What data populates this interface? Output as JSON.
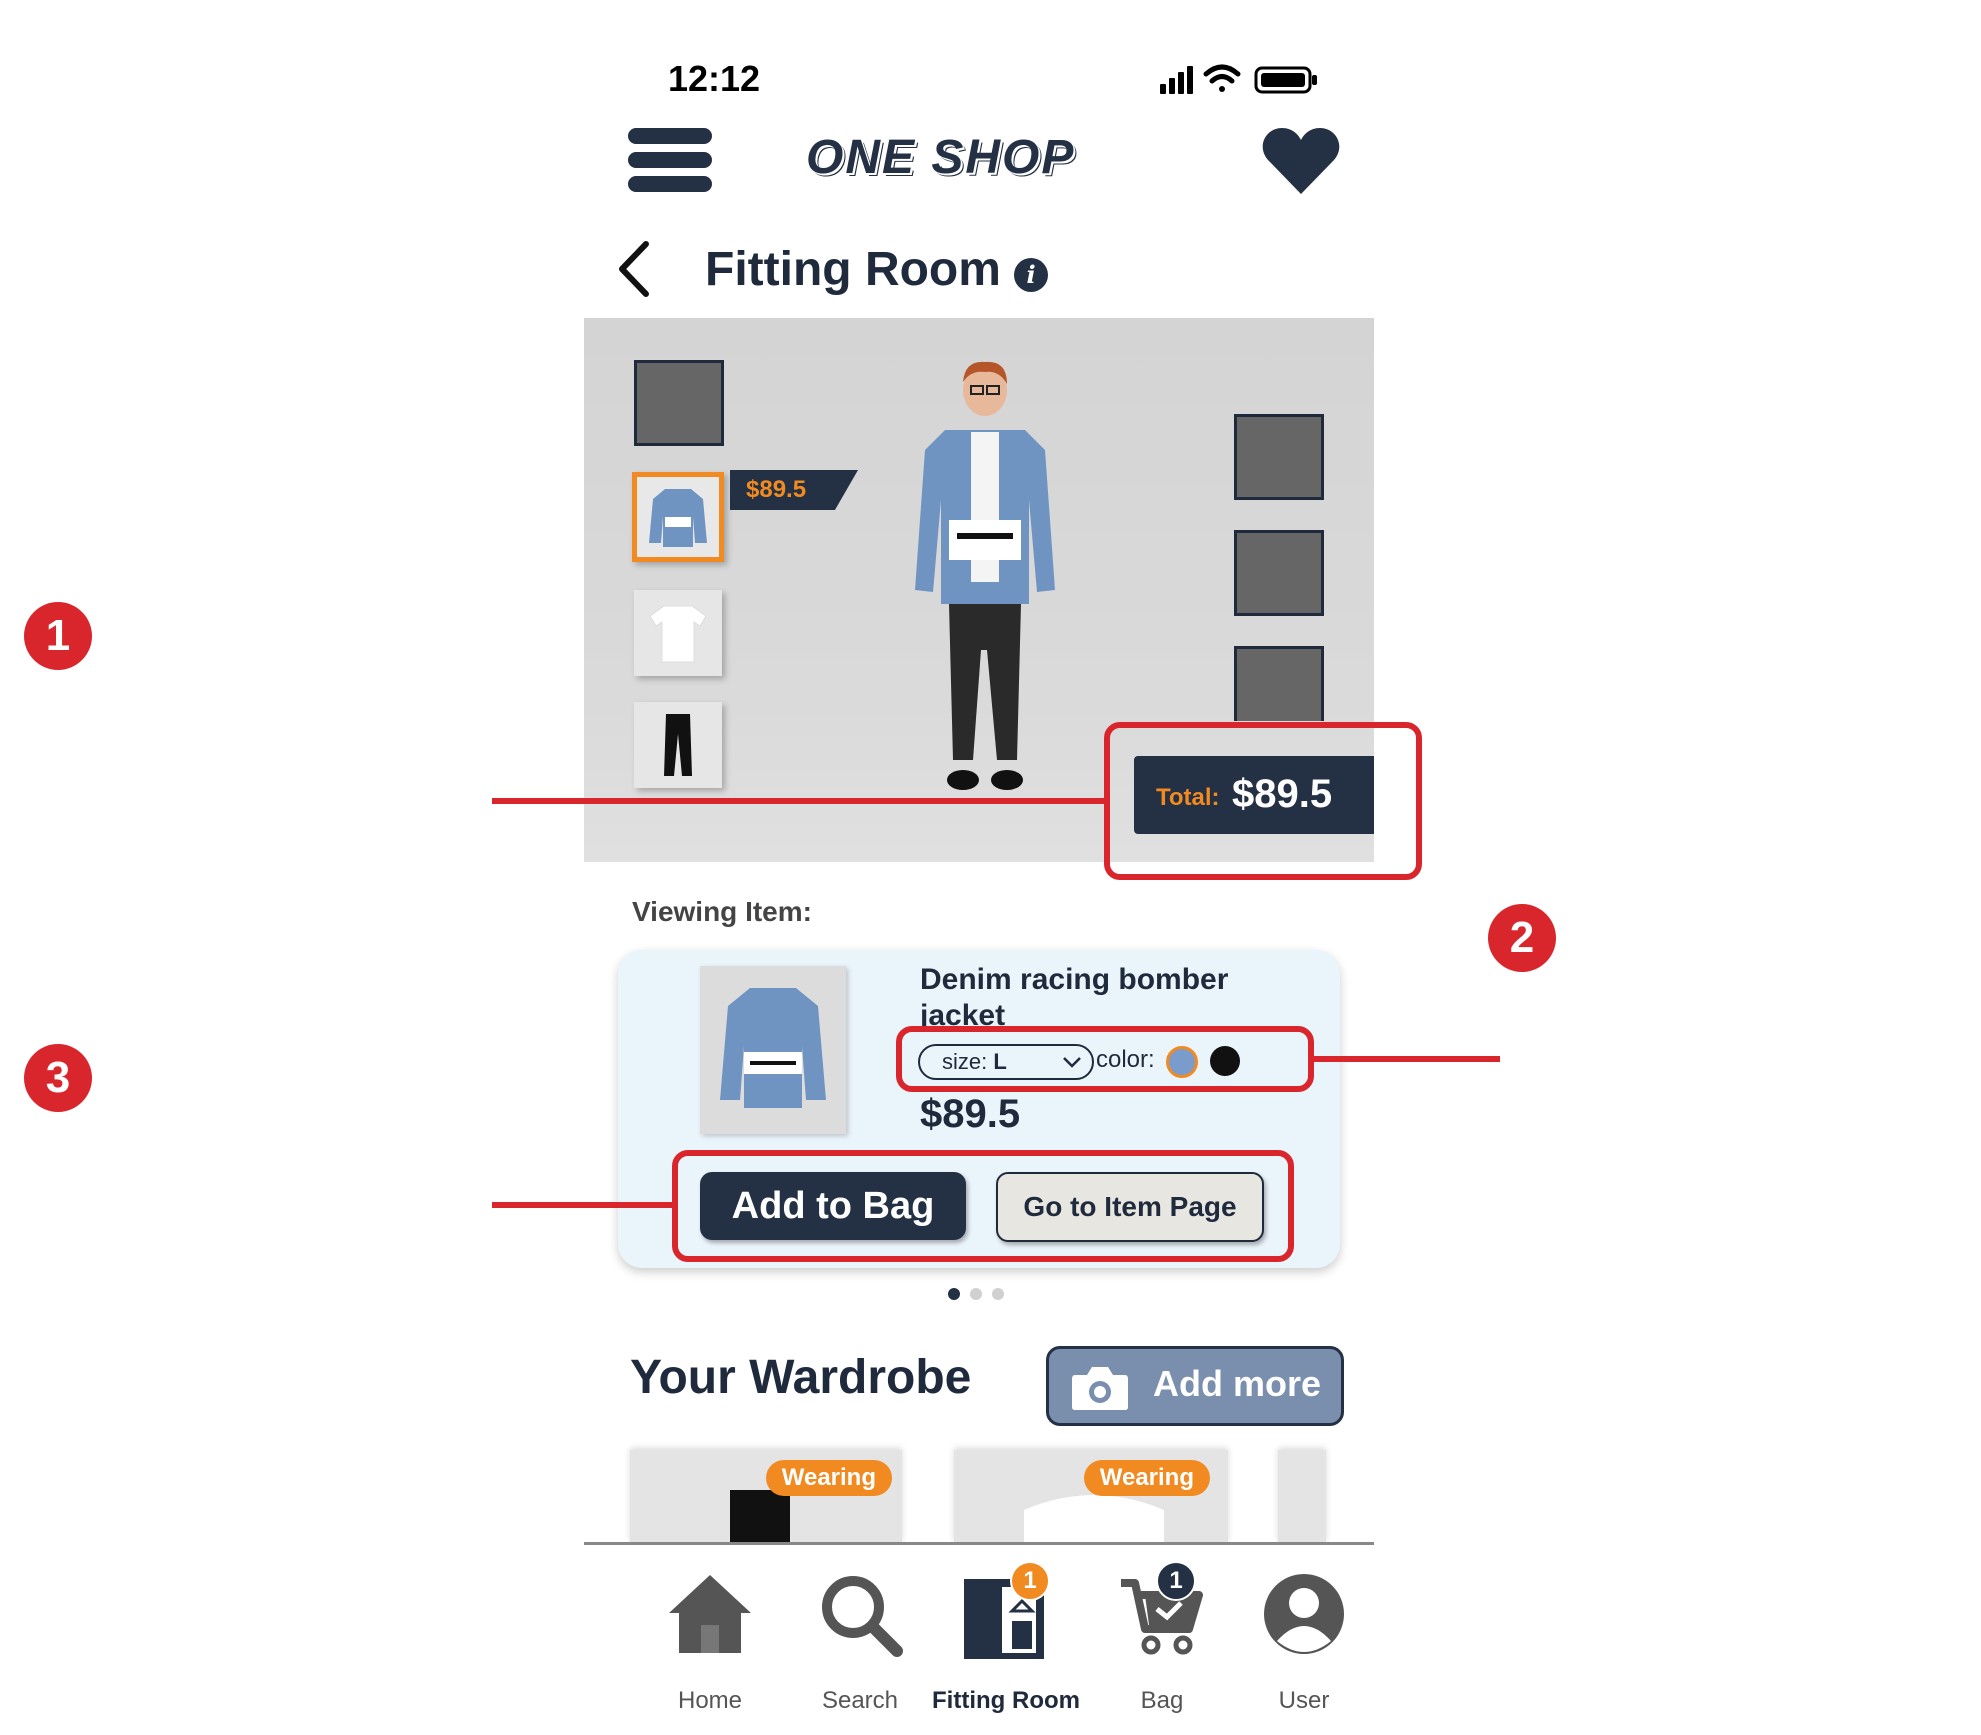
{
  "status_bar": {
    "time": "12:12"
  },
  "header": {
    "logo_text": "ONE SHOP"
  },
  "title_row": {
    "title": "Fitting Room"
  },
  "stage": {
    "selected_item_price": "$89.5",
    "total_label": "Total:",
    "total_value": "$89.5"
  },
  "annotations": {
    "badge_1": "1",
    "badge_2": "2",
    "badge_3": "3"
  },
  "viewing": {
    "label": "Viewing Item:",
    "item_name": "Denim racing bomber jacket",
    "size_label": "size:",
    "size_value": "L",
    "color_label": "color:",
    "colors": [
      "#7a9ccc",
      "#111111"
    ],
    "price": "$89.5",
    "add_to_bag": "Add to Bag",
    "go_to_item": "Go to Item Page",
    "page_dots": {
      "count": 3,
      "active": 0
    }
  },
  "wardrobe": {
    "title": "Your Wardrobe",
    "add_more": "Add more",
    "cards": [
      {
        "badge": "Wearing"
      },
      {
        "badge": "Wearing"
      }
    ]
  },
  "nav": {
    "items": [
      {
        "label": "Home",
        "icon": "home-icon"
      },
      {
        "label": "Search",
        "icon": "search-icon"
      },
      {
        "label": "Fitting Room",
        "icon": "fitting-room-icon",
        "badge": "1",
        "active": true
      },
      {
        "label": "Bag",
        "icon": "cart-icon",
        "badge": "1"
      },
      {
        "label": "User",
        "icon": "user-icon"
      }
    ]
  },
  "colors": {
    "navy": "#243044",
    "orange": "#f18a20",
    "annotation_red": "#d9262c",
    "card_bg": "#eaf4fb"
  }
}
